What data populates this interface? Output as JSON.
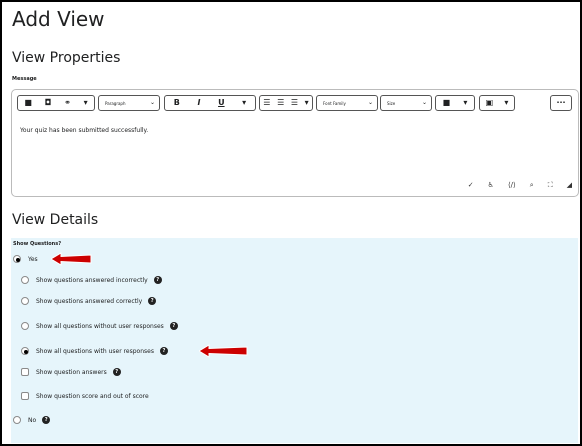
{
  "page": {
    "title": "Add View"
  },
  "properties": {
    "heading": "View Properties",
    "message_label": "Message",
    "toolbar": {
      "paragraph": "Paragraph",
      "bold": "B",
      "italic": "I",
      "underline": "U",
      "font_family": "Font Family",
      "size": "Size",
      "more": "···"
    },
    "editor_text": "Your quiz has been submitted successfully."
  },
  "details": {
    "heading": "View Details",
    "show_questions_label": "Show Questions?",
    "options": [
      {
        "label": "Yes",
        "type": "radio",
        "checked": true
      },
      {
        "label": "Show questions answered incorrectly",
        "type": "radio",
        "checked": false
      },
      {
        "label": "Show questions answered correctly",
        "type": "radio",
        "checked": false
      },
      {
        "label": "Show all questions without user responses",
        "type": "radio",
        "checked": false
      },
      {
        "label": "Show all questions with user responses",
        "type": "radio",
        "checked": true
      },
      {
        "label": "Show question answers",
        "type": "checkbox",
        "checked": false
      },
      {
        "label": "Show question score and out of score",
        "type": "checkbox",
        "checked": false
      },
      {
        "label": "No",
        "type": "radio",
        "checked": false
      }
    ],
    "help_glyph": "?"
  },
  "colors": {
    "annotation_arrow": "#cc0000",
    "details_bg": "#e6f5fb"
  }
}
